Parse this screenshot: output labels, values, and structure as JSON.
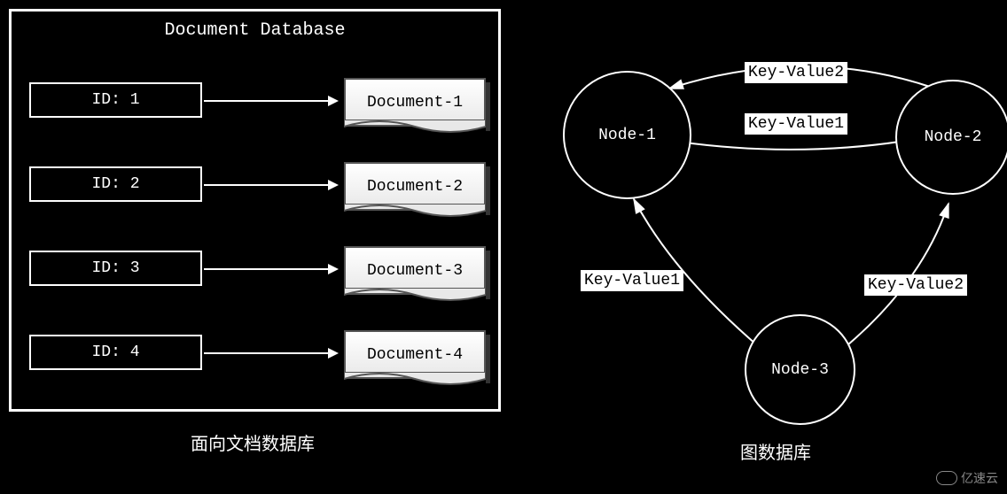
{
  "left_diagram": {
    "title": "Document Database",
    "rows": [
      {
        "key": "ID: 1",
        "doc": "Document-1"
      },
      {
        "key": "ID: 2",
        "doc": "Document-2"
      },
      {
        "key": "ID: 3",
        "doc": "Document-3"
      },
      {
        "key": "ID: 4",
        "doc": "Document-4"
      }
    ],
    "caption": "面向文档数据库"
  },
  "right_diagram": {
    "nodes": {
      "node1": "Node-1",
      "node2": "Node-2",
      "node3": "Node-3"
    },
    "edges": {
      "n1_n2_top": "Key-Value2",
      "n1_n2_bottom": "Key-Value1",
      "n3_n1": "Key-Value1",
      "n3_n2": "Key-Value2"
    },
    "caption": "图数据库"
  },
  "watermark": "亿速云"
}
